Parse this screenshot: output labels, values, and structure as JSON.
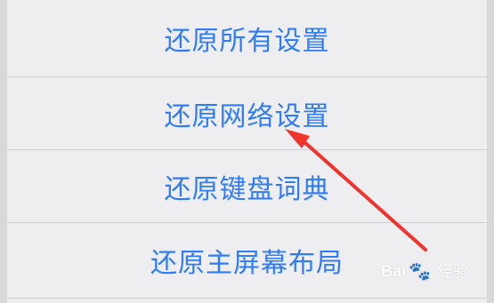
{
  "menu": {
    "items": [
      {
        "label": "还原所有设置"
      },
      {
        "label": "还原网络设置"
      },
      {
        "label": "还原键盘词典"
      },
      {
        "label": "还原主屏幕布局"
      }
    ]
  },
  "watermark": {
    "brand": "Bai",
    "paw_icon": "paw-icon",
    "suffix": "经验"
  },
  "annotation": {
    "arrow_color": "#f0342d"
  }
}
